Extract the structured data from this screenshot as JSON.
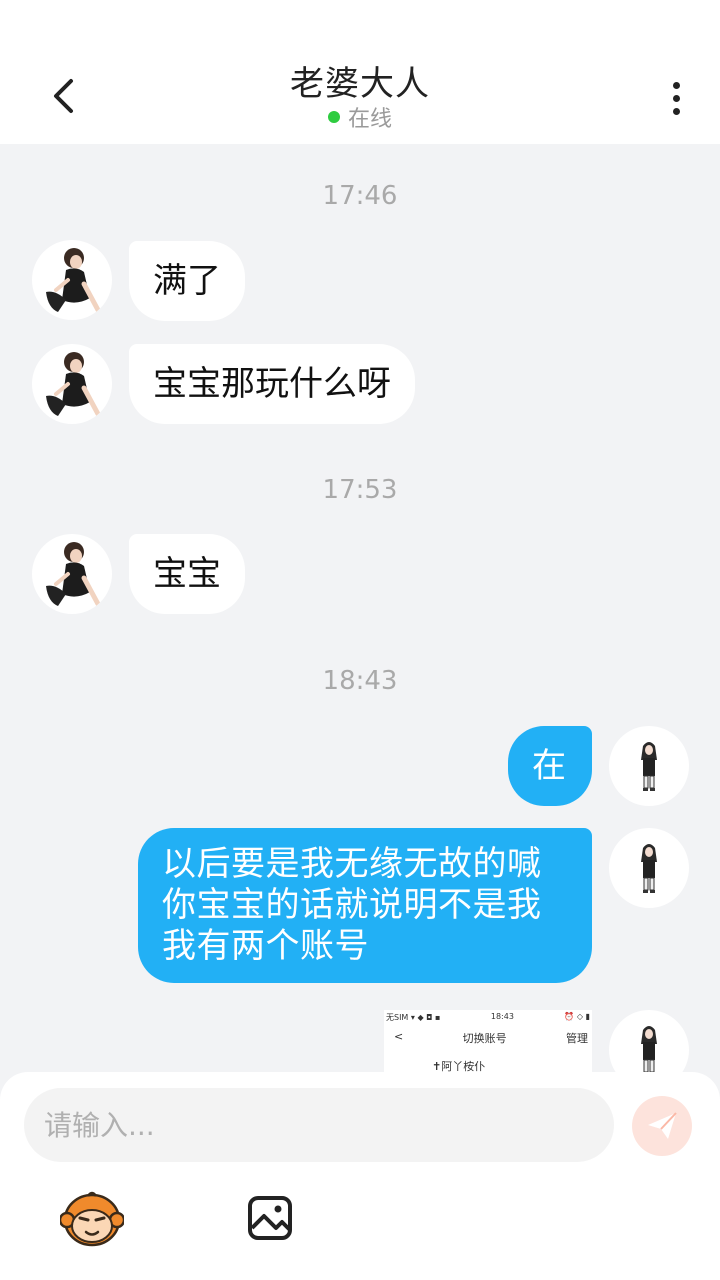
{
  "header": {
    "title": "老婆大人",
    "status": "在线",
    "status_color": "#2ecc40"
  },
  "messages": {
    "time_1": "17:46",
    "msg_1": "满了",
    "msg_2": "宝宝那玩什么呀",
    "time_2": "17:53",
    "msg_3": "宝宝",
    "time_3": "18:43",
    "msg_4": "在",
    "msg_5": "以后要是我无缘无故的喊你宝宝的话就说明不是我我有两个账号"
  },
  "image_message": {
    "status_left": "无SIM ▾ ◆ ◘ ▪",
    "status_time": "18:43",
    "status_right": "⏰ ◇ ▮",
    "back": "<",
    "page_title": "切换账号",
    "manage": "管理",
    "account": "✝阿丫桉仆"
  },
  "input": {
    "placeholder": "请输入..."
  },
  "colors": {
    "outgoing_bubble": "#22b0f5",
    "incoming_bubble": "#ffffff",
    "background": "#f2f3f5",
    "send_button": "#fde3dc"
  },
  "icons": {
    "back": "chevron-left-icon",
    "more": "more-vertical-icon",
    "send": "paper-plane-icon",
    "emoji": "monkey-face-icon",
    "image": "image-icon"
  }
}
